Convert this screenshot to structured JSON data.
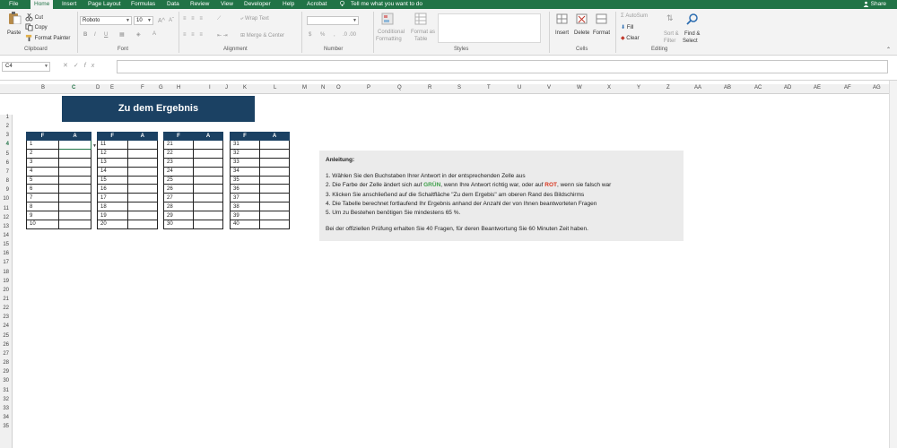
{
  "tabs": [
    "File",
    "Home",
    "Insert",
    "Page Layout",
    "Formulas",
    "Data",
    "Review",
    "View",
    "Developer",
    "Help",
    "Acrobat"
  ],
  "active_tab": "Home",
  "tell_me": "Tell me what you want to do",
  "share": "Share",
  "ribbon": {
    "clipboard": {
      "paste": "Paste",
      "cut": "Cut",
      "copy": "Copy",
      "format_painter": "Format Painter",
      "label": "Clipboard"
    },
    "font": {
      "family": "Roboto",
      "size": "10",
      "bold": "B",
      "italic": "I",
      "underline": "U",
      "label": "Font"
    },
    "alignment": {
      "wrap_text": "Wrap Text",
      "merge_center": "Merge & Center",
      "label": "Alignment"
    },
    "number": {
      "label": "Number"
    },
    "styles": {
      "conditional": "Conditional",
      "formatting": "Formatting",
      "format_as": "Format as",
      "table": "Table",
      "label": "Styles"
    },
    "cells": {
      "insert": "Insert",
      "delete": "Delete",
      "format": "Format",
      "label": "Cells"
    },
    "editing": {
      "autosum": "AutoSum",
      "fill": "Fill",
      "clear": "Clear",
      "sort": "Sort &",
      "filter": "Filter",
      "find": "Find &",
      "select": "Select",
      "label": "Editing"
    }
  },
  "name_box": "C4",
  "columns": [
    "B",
    "C",
    "D",
    "E",
    "F",
    "G",
    "H",
    "I",
    "J",
    "K",
    "L",
    "M",
    "N",
    "O",
    "P",
    "Q",
    "R",
    "S",
    "T",
    "U",
    "V",
    "W",
    "X",
    "Y",
    "Z",
    "AA",
    "AB",
    "AC",
    "AD",
    "AE",
    "AF",
    "AG"
  ],
  "rows": [
    "1",
    "2",
    "3",
    "4",
    "5",
    "6",
    "7",
    "8",
    "9",
    "10",
    "11",
    "12",
    "13",
    "14",
    "15",
    "16",
    "17",
    "18",
    "19",
    "20",
    "21",
    "22",
    "23",
    "24",
    "25",
    "26",
    "27",
    "28",
    "29",
    "30",
    "31",
    "32",
    "33",
    "34",
    "35"
  ],
  "selected_row": "4",
  "banner": "Zu dem Ergebnis",
  "answer_tables": {
    "header_f": "F",
    "header_a": "A",
    "groups": [
      [
        "1",
        "2",
        "3",
        "4",
        "5",
        "6",
        "7",
        "8",
        "9",
        "10"
      ],
      [
        "11",
        "12",
        "13",
        "14",
        "15",
        "16",
        "17",
        "18",
        "19",
        "20"
      ],
      [
        "21",
        "22",
        "23",
        "24",
        "25",
        "26",
        "27",
        "28",
        "29",
        "30"
      ],
      [
        "31",
        "32",
        "33",
        "34",
        "35",
        "36",
        "37",
        "38",
        "39",
        "40"
      ]
    ]
  },
  "instructions": {
    "heading": "Anleitung:",
    "line1": "1. Wählen Sie den Buchstaben Ihrer Antwort in der entsprechenden Zelle aus",
    "line2_a": "2. Die Farbe der Zelle ändert sich auf ",
    "line2_green": "GRÜN",
    "line2_b": ", wenn Ihre Antwort richtig war, oder auf ",
    "line2_red": "ROT",
    "line2_c": ", wenn sie falsch war",
    "line3": "3. Klicken Sie anschließend auf die Schaltfläche \"Zu dem Ergebis\" am oberen Rand des Bildschirms",
    "line4": "4. Die Tabelle berechnet fortlaufend Ihr Ergebnis anhand der Anzahl der von Ihnen beantworteten Fragen",
    "line5": "5. Um zu Bestehen benötigen Sie mindestens 65 %.",
    "footer": "Bei der offiziellen Prüfung erhalten Sie 40 Fragen, für deren Beantwortung Sie 60 Minuten Zeit haben."
  },
  "colors": {
    "excel_green": "#217346",
    "header_navy": "#1b4163",
    "correct_green": "#3fa04a",
    "wrong_red": "#d9351d"
  }
}
